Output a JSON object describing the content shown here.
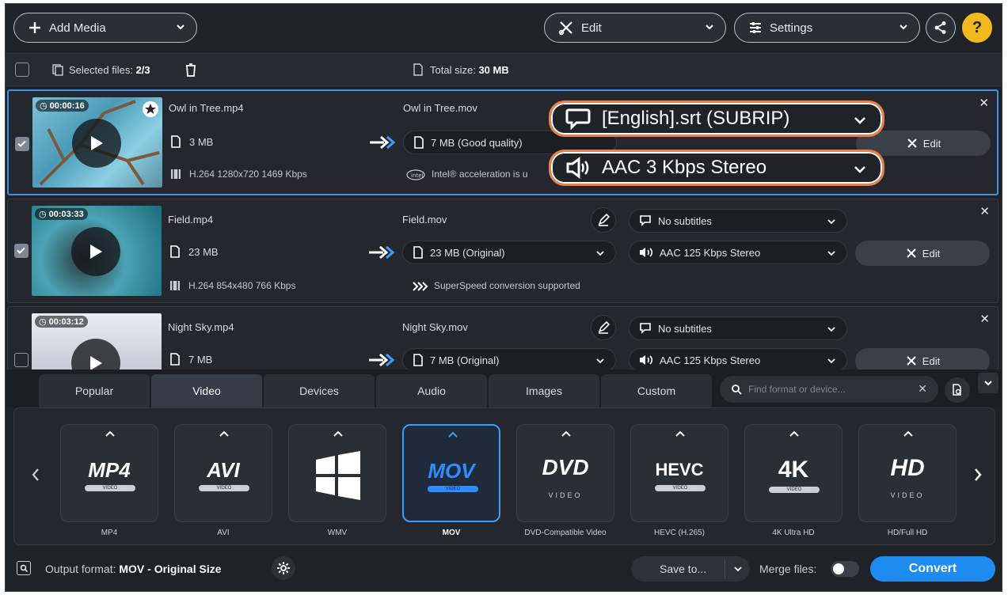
{
  "toolbar": {
    "add_media": "Add Media",
    "edit": "Edit",
    "settings": "Settings",
    "help": "?"
  },
  "selection": {
    "selected_label": "Selected files:",
    "selected_value": "2/3",
    "total_label": "Total size:",
    "total_value": "30 MB"
  },
  "files": [
    {
      "duration": "00:00:16",
      "name": "Owl in Tree.mp4",
      "size": "3 MB",
      "codec": "H.264 1280x720 1469 Kbps",
      "out_name": "Owl in Tree.mov",
      "out_size": "7 MB (Good quality)",
      "note": "Intel® acceleration is u",
      "subtitle": "[English].srt (SUBRIP)",
      "audio": "AAC 3 Kbps Stereo",
      "edit": "Edit",
      "checked": true
    },
    {
      "duration": "00:03:33",
      "name": "Field.mp4",
      "size": "23 MB",
      "codec": "H.264 854x480 766 Kbps",
      "out_name": "Field.mov",
      "out_size": "23 MB (Original)",
      "note": "SuperSpeed conversion supported",
      "subtitle": "No subtitles",
      "audio": "AAC 125 Kbps Stereo",
      "edit": "Edit",
      "checked": true
    },
    {
      "duration": "00:03:12",
      "name": "Night Sky.mp4",
      "size": "7 MB",
      "out_name": "Night Sky.mov",
      "out_size": "7 MB (Original)",
      "subtitle": "No subtitles",
      "audio": "AAC 125 Kbps Stereo",
      "edit": "Edit",
      "checked": false
    }
  ],
  "tabs": [
    "Popular",
    "Video",
    "Devices",
    "Audio",
    "Images",
    "Custom"
  ],
  "active_tab": "Video",
  "search": {
    "placeholder": "Find format or device..."
  },
  "formats": [
    {
      "logo": "MP4",
      "sub": "VIDEO",
      "label": "MP4"
    },
    {
      "logo": "AVI",
      "sub": "VIDEO",
      "label": "AVI"
    },
    {
      "logo": "windows-logo",
      "label": "WMV"
    },
    {
      "logo": "MOV",
      "sub": "VIDEO",
      "label": "MOV"
    },
    {
      "logo": "DVD",
      "sub": "VIDEO",
      "label": "DVD-Compatible Video"
    },
    {
      "logo": "HEVC",
      "sub": "VIDEO",
      "label": "HEVC (H.265)"
    },
    {
      "logo": "4K",
      "sub": "VIDEO",
      "label": "4K Ultra HD"
    },
    {
      "logo": "HD",
      "sub": "VIDEO",
      "label": "HD/Full HD"
    }
  ],
  "active_format": "MOV",
  "bottom": {
    "output_label": "Output format:",
    "output_value": "MOV - Original Size",
    "save_to": "Save to...",
    "merge": "Merge files:",
    "convert": "Convert"
  },
  "colors": {
    "accent": "#1e8bf0",
    "callout": "#e8804a",
    "help": "#f2b91f"
  }
}
